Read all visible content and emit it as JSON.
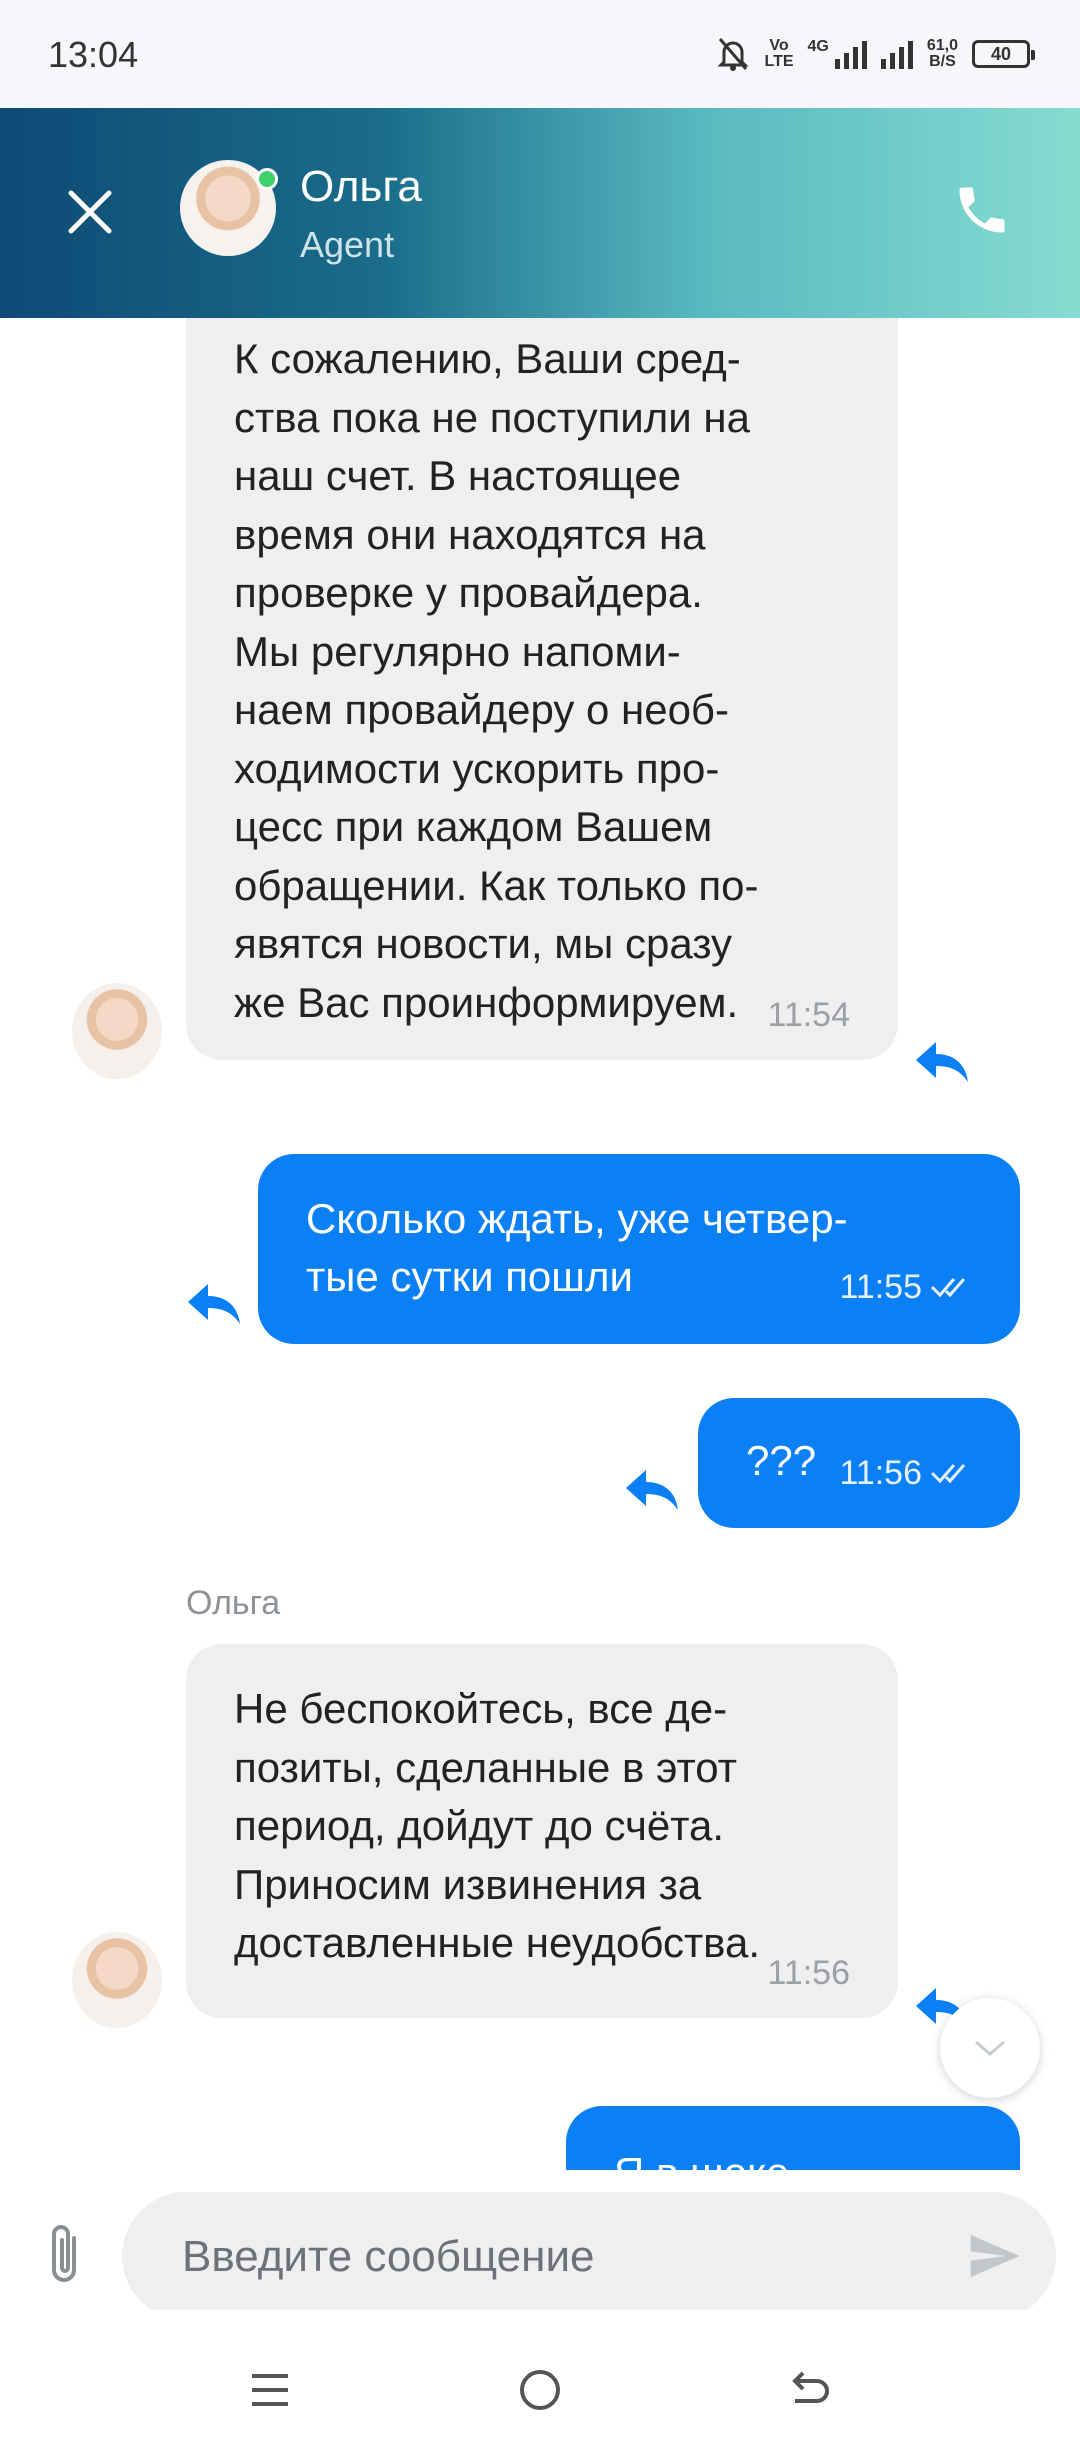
{
  "status": {
    "time": "13:04",
    "network_top": "Vo",
    "network_bottom": "LTE",
    "gen": "4G",
    "speed_top": "61,0",
    "speed_bottom": "B/S",
    "battery": "40"
  },
  "header": {
    "name": "Ольга",
    "role": "Agent"
  },
  "messages": [
    {
      "from": "agent",
      "text": "К сожалению, Ваши сред-\nства пока не поступили на\nнаш счет. В настоящее\nвремя они находятся на\nпроверке у провайдера.\nМы регулярно напоми-\nнаем провайдеру о необ-\nходимости ускорить про-\nцесс при каждом Вашем\nобращении. Как только по-\nявятся новости, мы сразу\nже Вас проинформируем.",
      "time": "11:54"
    },
    {
      "from": "user",
      "text": "Сколько ждать, уже четвер-\nтые сутки пошли",
      "time": "11:55"
    },
    {
      "from": "user",
      "text": "???",
      "time": "11:56"
    },
    {
      "from": "agent",
      "sender": "Ольга",
      "text": "Не беспокойтесь, все де-\nпозиты, сделанные в этот\nпериод, дойдут до счёта.\nПриносим извинения за\nдоставленные неудобства.",
      "time": "11:56"
    },
    {
      "from": "user",
      "text": "Я в шоке",
      "partial": true
    }
  ],
  "composer": {
    "placeholder": "Введите сообщение"
  },
  "colors": {
    "outgoing_bubble": "#0b80f5",
    "incoming_bubble": "#efefef",
    "header_gradient_start": "#0e4a74",
    "header_gradient_end": "#86dcd0"
  },
  "icons": {
    "close": "close-icon",
    "call": "phone-icon",
    "reply": "reply-icon",
    "read": "double-check-icon",
    "attach": "paperclip-icon",
    "send": "send-icon",
    "scroll": "chevron-down-icon"
  }
}
